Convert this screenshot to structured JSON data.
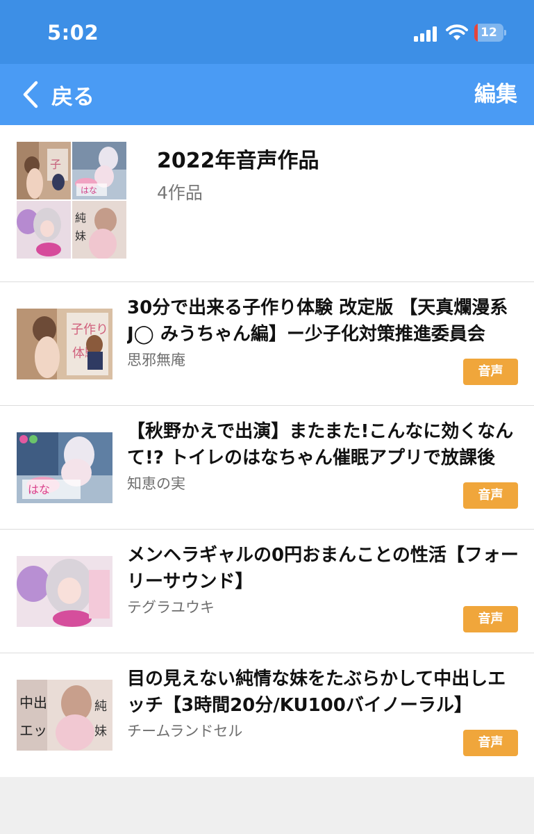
{
  "status_bar": {
    "time": "5:02",
    "battery": "12",
    "battery_fraction": 0.12
  },
  "nav": {
    "back_label": "戻る",
    "edit_label": "編集"
  },
  "collection": {
    "title": "2022年音声作品",
    "count": "4作品"
  },
  "items": [
    {
      "title": "30分で出来る子作り体験 改定版 【天真爛漫系J◯ みうちゃん編】ー少子化対策推進委員会",
      "circle": "思邪無庵",
      "badge": "音声"
    },
    {
      "title": "【秋野かえで出演】またまた!こんなに効くなんて!? トイレのはなちゃん催眠アプリで放課後",
      "circle": "知恵の実",
      "badge": "音声"
    },
    {
      "title": "メンヘラギャルの0円おまんことの性活【フォーリーサウンド】",
      "circle": "テグラユウキ",
      "badge": "音声"
    },
    {
      "title": "目の見えない純情な妹をたぶらかして中出しエッチ【3時間20分/KU100バイノーラル】",
      "circle": "チームランドセル",
      "badge": "音声"
    }
  ],
  "colors": {
    "statusbar": "#3d8fe6",
    "navbar": "#4a9bf4",
    "badge": "#f0a63b",
    "battery_low": "#e5453b"
  }
}
